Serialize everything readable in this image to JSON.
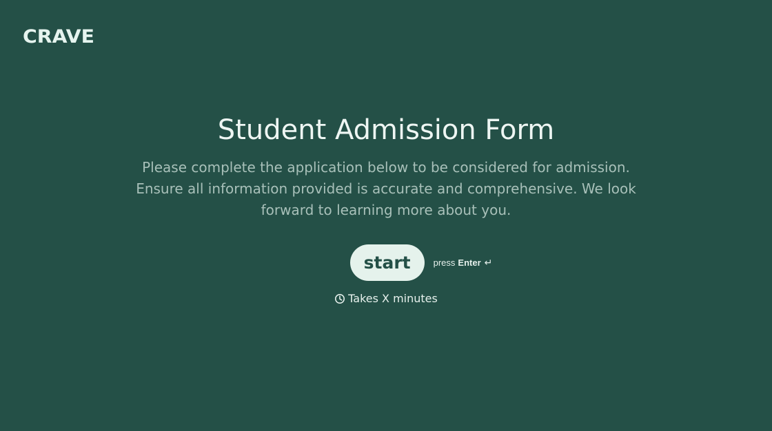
{
  "brand": {
    "logo_text": "CRAVE"
  },
  "form": {
    "title": "Student Admission Form",
    "description": "Please complete the application below to be considered for admission. Ensure all information provided is accurate and comprehensive. We look forward to learning more about you.",
    "start_label": "start",
    "hint_prefix": "press",
    "hint_key": "Enter",
    "hint_icon": "↵",
    "duration_text": "Takes X minutes"
  },
  "colors": {
    "background": "#245047",
    "button_background": "#e5f2ec",
    "button_text": "#245047",
    "description_text": "#a8c0b9"
  },
  "icons": {
    "duration": "clock-icon",
    "enter": "return-icon"
  }
}
